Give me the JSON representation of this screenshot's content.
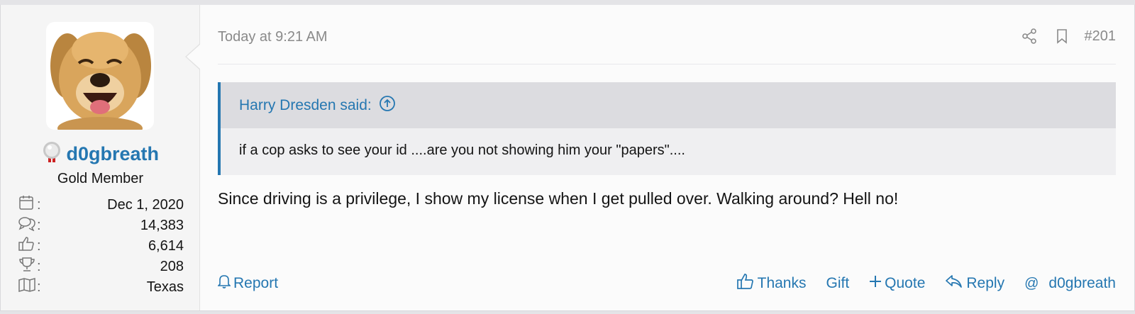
{
  "post": {
    "timestamp": "Today at 9:21 AM",
    "post_number": "#201",
    "user": {
      "username": "d0gbreath",
      "title": "Gold Member",
      "stats": [
        {
          "icon": "calendar-icon",
          "value": "Dec 1, 2020"
        },
        {
          "icon": "messages-icon",
          "value": "14,383"
        },
        {
          "icon": "thumbs-up-icon",
          "value": "6,614"
        },
        {
          "icon": "trophy-icon",
          "value": "208"
        },
        {
          "icon": "map-icon",
          "value": "Texas"
        }
      ],
      "colon": ":"
    },
    "quote": {
      "author": "Harry Dresden said:",
      "text": "if a cop asks to see your id ....are you not showing him your \"papers\"...."
    },
    "message": "Since driving is a privilege, I show my license when I get pulled over. Walking around? Hell no!",
    "actions": {
      "report": "Report",
      "thanks": "Thanks",
      "gift": "Gift",
      "quote": "Quote",
      "reply": "Reply",
      "mention_symbol": "@",
      "mention": "d0gbreath"
    }
  },
  "colors": {
    "link": "#2577b1",
    "quote_border": "#2577b1"
  }
}
